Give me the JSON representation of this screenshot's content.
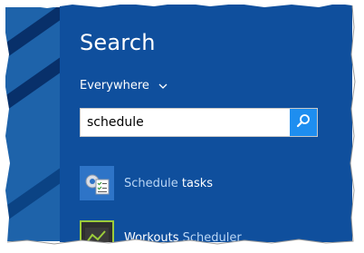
{
  "charm": {
    "title": "Search",
    "scope": "Everywhere",
    "query": "schedule"
  },
  "results": [
    {
      "match": "Schedule",
      "rest": " tasks",
      "icon": "task-scheduler-icon"
    },
    {
      "lead": "Workouts ",
      "match": "Scheduler",
      "icon": "workouts-app-icon"
    }
  ],
  "colors": {
    "panel": "#0f4f9d",
    "search_button": "#1e8ef0",
    "match_highlight": "#b9d6f5"
  }
}
